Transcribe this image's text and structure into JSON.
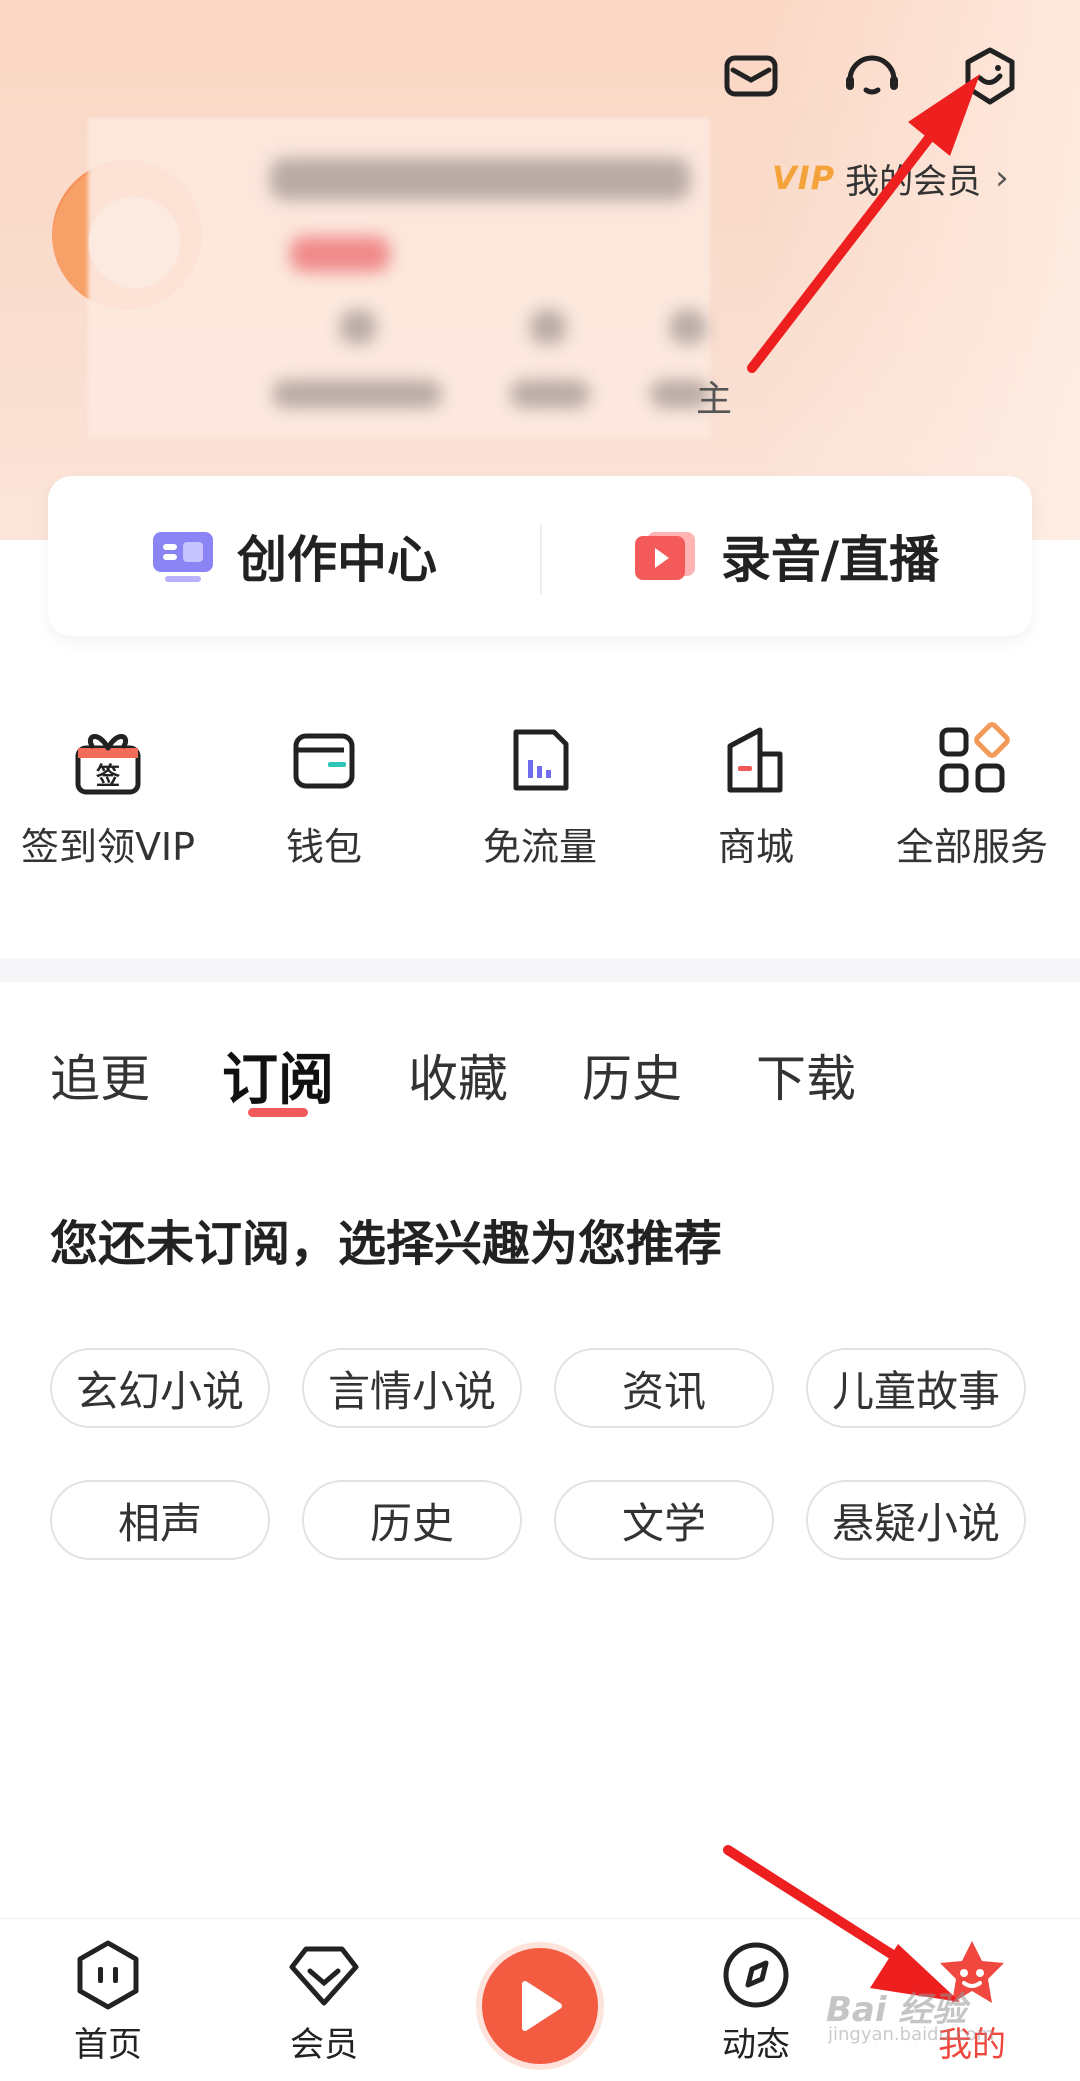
{
  "header": {
    "icons": [
      {
        "name": "mail-icon"
      },
      {
        "name": "customer-service-icon"
      },
      {
        "name": "skin-theme-icon"
      }
    ],
    "vip_badge": "VIP",
    "vip_label": "我的会员",
    "vip_chevron": "›",
    "profile_partial_text": "主"
  },
  "creator": {
    "creation_label": "创作中心",
    "record_label": "录音/直播"
  },
  "quick": [
    {
      "label": "签到领VIP",
      "icon": "gift-checkin-icon"
    },
    {
      "label": "钱包",
      "icon": "wallet-icon"
    },
    {
      "label": "免流量",
      "icon": "free-data-icon"
    },
    {
      "label": "商城",
      "icon": "mall-icon"
    },
    {
      "label": "全部服务",
      "icon": "all-services-icon"
    }
  ],
  "gift_badge": "签",
  "tabs": [
    {
      "label": "追更"
    },
    {
      "label": "订阅",
      "active": true
    },
    {
      "label": "收藏"
    },
    {
      "label": "历史"
    },
    {
      "label": "下载"
    }
  ],
  "recommend": {
    "title": "您还未订阅，选择兴趣为您推荐",
    "chips": [
      "玄幻小说",
      "言情小说",
      "资讯",
      "儿童故事",
      "相声",
      "历史",
      "文学",
      "悬疑小说"
    ]
  },
  "nav": [
    {
      "label": "首页",
      "icon": "home-icon"
    },
    {
      "label": "会员",
      "icon": "vip-diamond-icon"
    },
    {
      "label": "动态",
      "icon": "compass-icon"
    },
    {
      "label": "我的",
      "icon": "mine-icon",
      "active": true
    }
  ],
  "watermark": {
    "text": "Bai 经验",
    "sub": "jingyan.baidu.com"
  },
  "colors": {
    "accent": "#f0473f",
    "play": "#f45c42",
    "vip": "#f3a33a",
    "hero": "#fbd7c4"
  }
}
